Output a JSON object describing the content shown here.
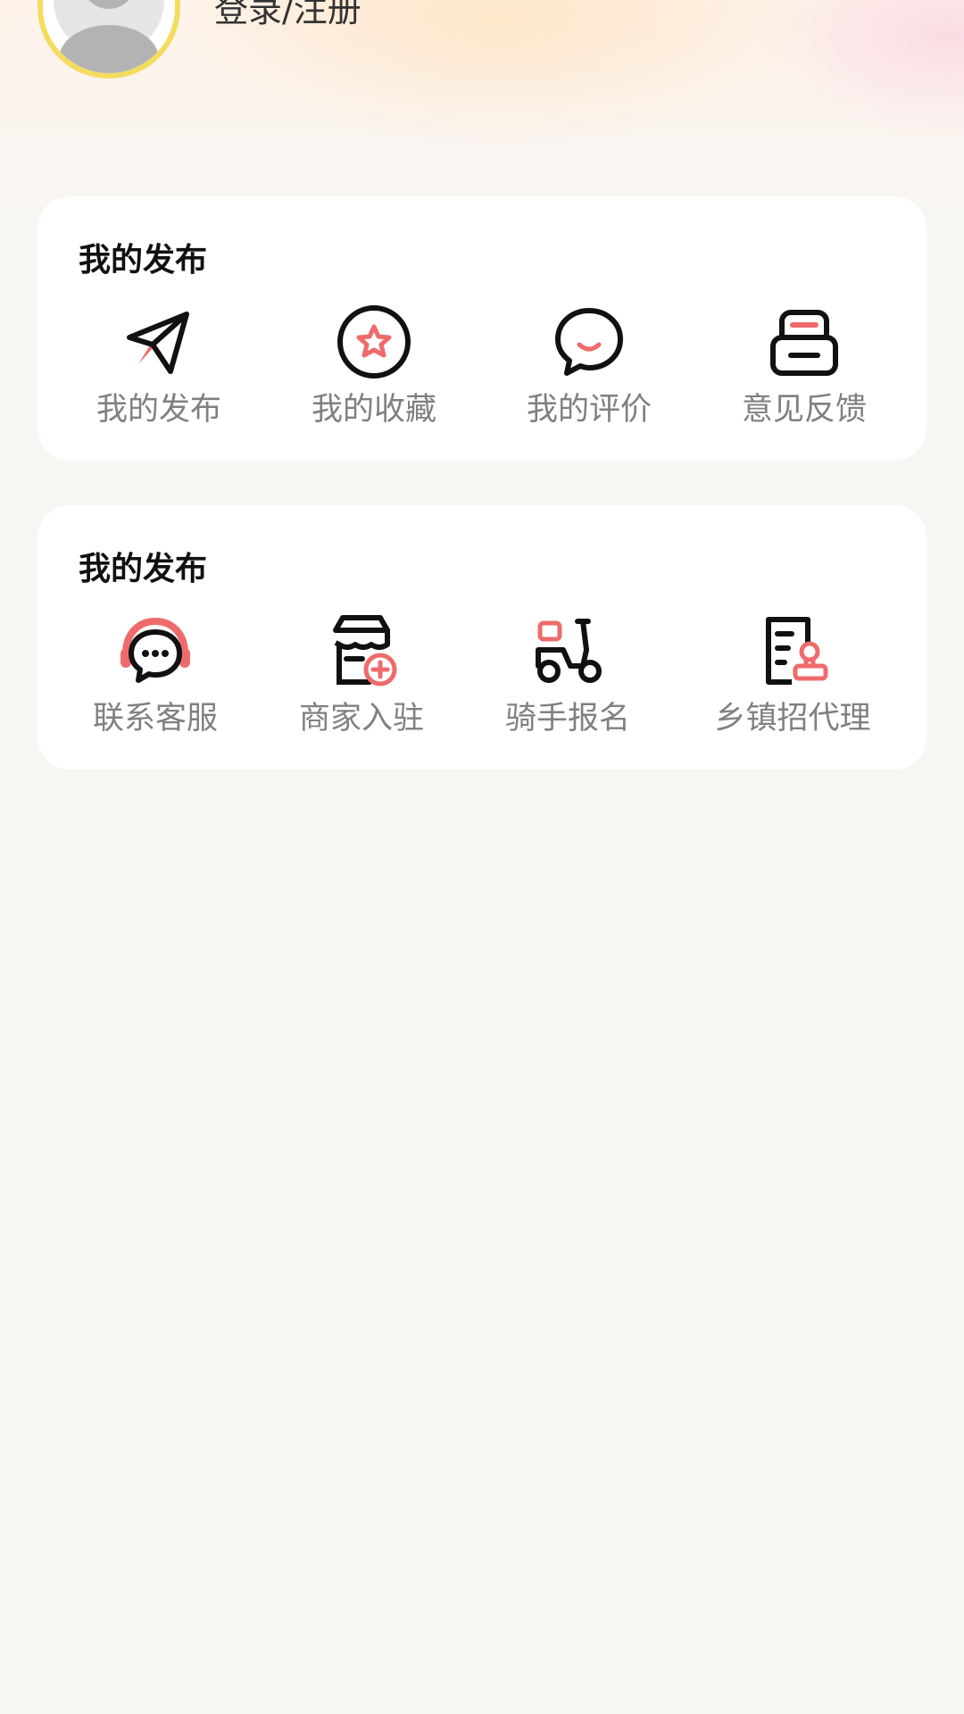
{
  "header": {
    "login_label": "登录/注册"
  },
  "sections": [
    {
      "title": "我的发布",
      "items": [
        {
          "label": "我的发布",
          "icon": "paper-plane-icon"
        },
        {
          "label": "我的收藏",
          "icon": "star-circle-icon"
        },
        {
          "label": "我的评价",
          "icon": "chat-bubble-icon"
        },
        {
          "label": "意见反馈",
          "icon": "inbox-icon"
        }
      ]
    },
    {
      "title": "我的发布",
      "items": [
        {
          "label": "联系客服",
          "icon": "headset-icon"
        },
        {
          "label": "商家入驻",
          "icon": "store-add-icon"
        },
        {
          "label": "骑手报名",
          "icon": "scooter-icon"
        },
        {
          "label": "乡镇招代理",
          "icon": "document-stamp-icon"
        }
      ]
    }
  ],
  "colors": {
    "accent": "#ef6b6b",
    "avatar_ring": "#f4dc5e",
    "label": "#808080"
  }
}
